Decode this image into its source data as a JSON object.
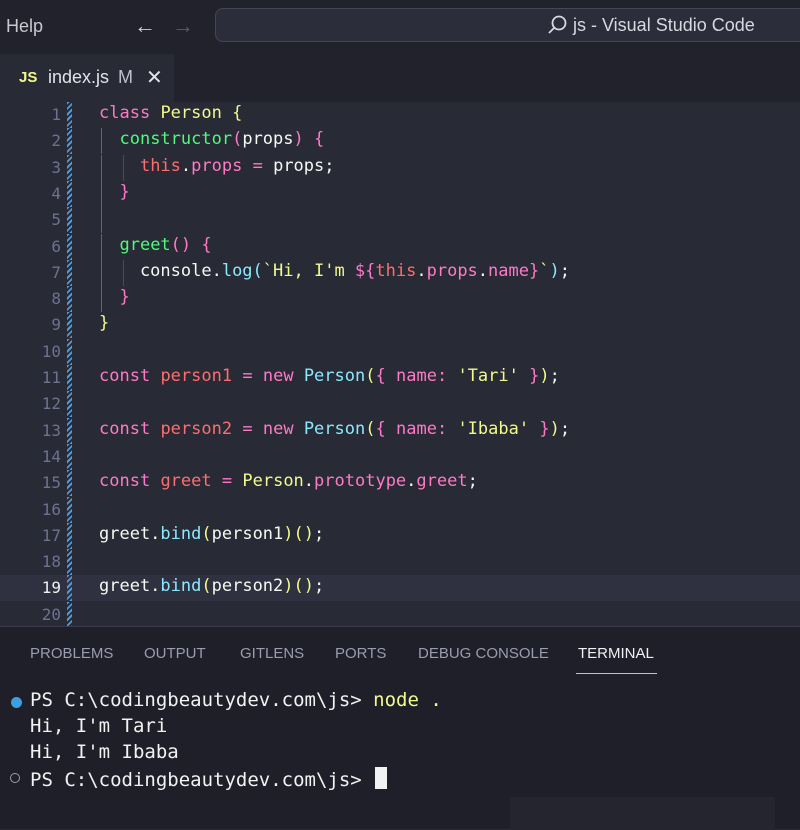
{
  "titlebar": {
    "menu": "Help",
    "back_icon": "arrow-left-icon",
    "forward_icon": "arrow-right-icon",
    "search_icon": "search-icon",
    "command_center_title": "js - Visual Studio Code"
  },
  "tab": {
    "lang_badge": "JS",
    "filename": "index.js",
    "modified": "M",
    "close": "✕"
  },
  "editor": {
    "current_line": 19,
    "lines": [
      {
        "n": "1",
        "code": "class Person {"
      },
      {
        "n": "2",
        "code": "  constructor(props) {"
      },
      {
        "n": "3",
        "code": "    this.props = props;"
      },
      {
        "n": "4",
        "code": "  }"
      },
      {
        "n": "5",
        "code": ""
      },
      {
        "n": "6",
        "code": "  greet() {"
      },
      {
        "n": "7",
        "code": "    console.log(`Hi, I'm ${this.props.name}`);"
      },
      {
        "n": "8",
        "code": "  }"
      },
      {
        "n": "9",
        "code": "}"
      },
      {
        "n": "10",
        "code": ""
      },
      {
        "n": "11",
        "code": "const person1 = new Person({ name: 'Tari' });"
      },
      {
        "n": "12",
        "code": ""
      },
      {
        "n": "13",
        "code": "const person2 = new Person({ name: 'Ibaba' });"
      },
      {
        "n": "14",
        "code": ""
      },
      {
        "n": "15",
        "code": "const greet = Person.prototype.greet;"
      },
      {
        "n": "16",
        "code": ""
      },
      {
        "n": "17",
        "code": "greet.bind(person1)();"
      },
      {
        "n": "18",
        "code": ""
      },
      {
        "n": "19",
        "code": "greet.bind(person2)();"
      },
      {
        "n": "20",
        "code": ""
      }
    ]
  },
  "panel": {
    "tabs": [
      "PROBLEMS",
      "OUTPUT",
      "GITLENS",
      "PORTS",
      "DEBUG CONSOLE",
      "TERMINAL"
    ],
    "active_tab": "TERMINAL",
    "terminal": {
      "prompt1": "PS C:\\codingbeautydev.com\\js> ",
      "command1": "node .",
      "output1": "Hi, I'm Tari",
      "output2": "Hi, I'm Ibaba",
      "prompt2": "PS C:\\codingbeautydev.com\\js> "
    }
  },
  "colors": {
    "keyword": "#ff79c6",
    "class_name": "#f1fa8c",
    "function": "#50fa7b",
    "builtin": "#8be9fd",
    "variable": "#ff6e6e",
    "string": "#f1fa8c",
    "terminal_success_dot": "#3aa0e0"
  }
}
